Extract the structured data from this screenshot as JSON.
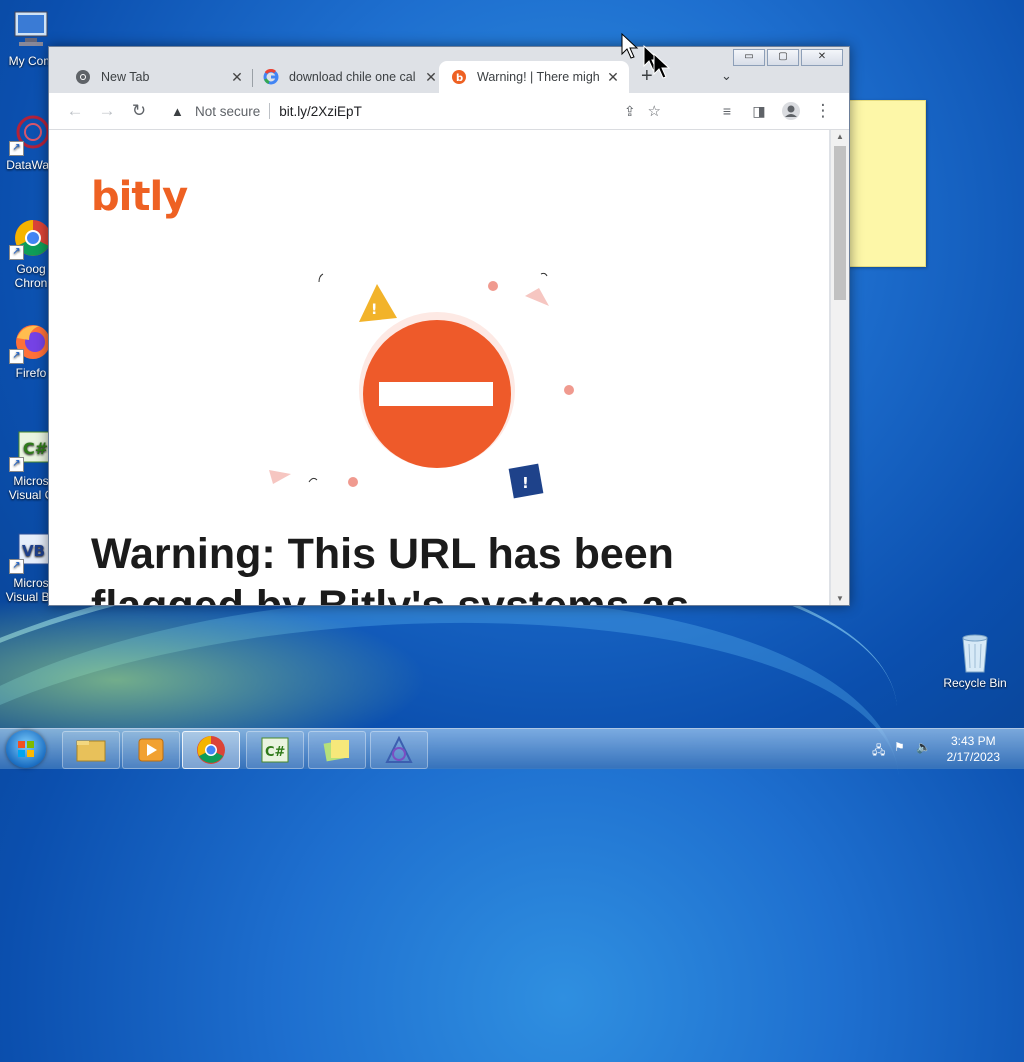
{
  "desktop": {
    "icons": [
      {
        "label": "My Com"
      },
      {
        "label": "DataWag"
      },
      {
        "label": "Goog Chron"
      },
      {
        "label": "Firefo"
      },
      {
        "label": "Micros Visual C"
      },
      {
        "label": "Micros Visual Ba"
      },
      {
        "label": "Recycle Bin"
      }
    ]
  },
  "browser": {
    "tabs": [
      {
        "title": "New Tab",
        "icon": "chrome-icon"
      },
      {
        "title": "download chile one cal",
        "icon": "google-icon"
      },
      {
        "title": "Warning! | There might",
        "icon": "bitly-icon",
        "active": true
      }
    ],
    "address": {
      "security": "Not secure",
      "url": "bit.ly/2XziEpT"
    },
    "page": {
      "logo": "bitly",
      "headline": "Warning: This URL has been flagged by Bitly's systems as"
    },
    "colors": {
      "accent": "#ee6123",
      "stop_sign": "#ee5a2a"
    }
  },
  "taskbar": {
    "time": "3:43 PM",
    "date": "2/17/2023",
    "apps": [
      "explorer",
      "media-player",
      "chrome",
      "csharp",
      "sticky-notes",
      "app"
    ]
  }
}
